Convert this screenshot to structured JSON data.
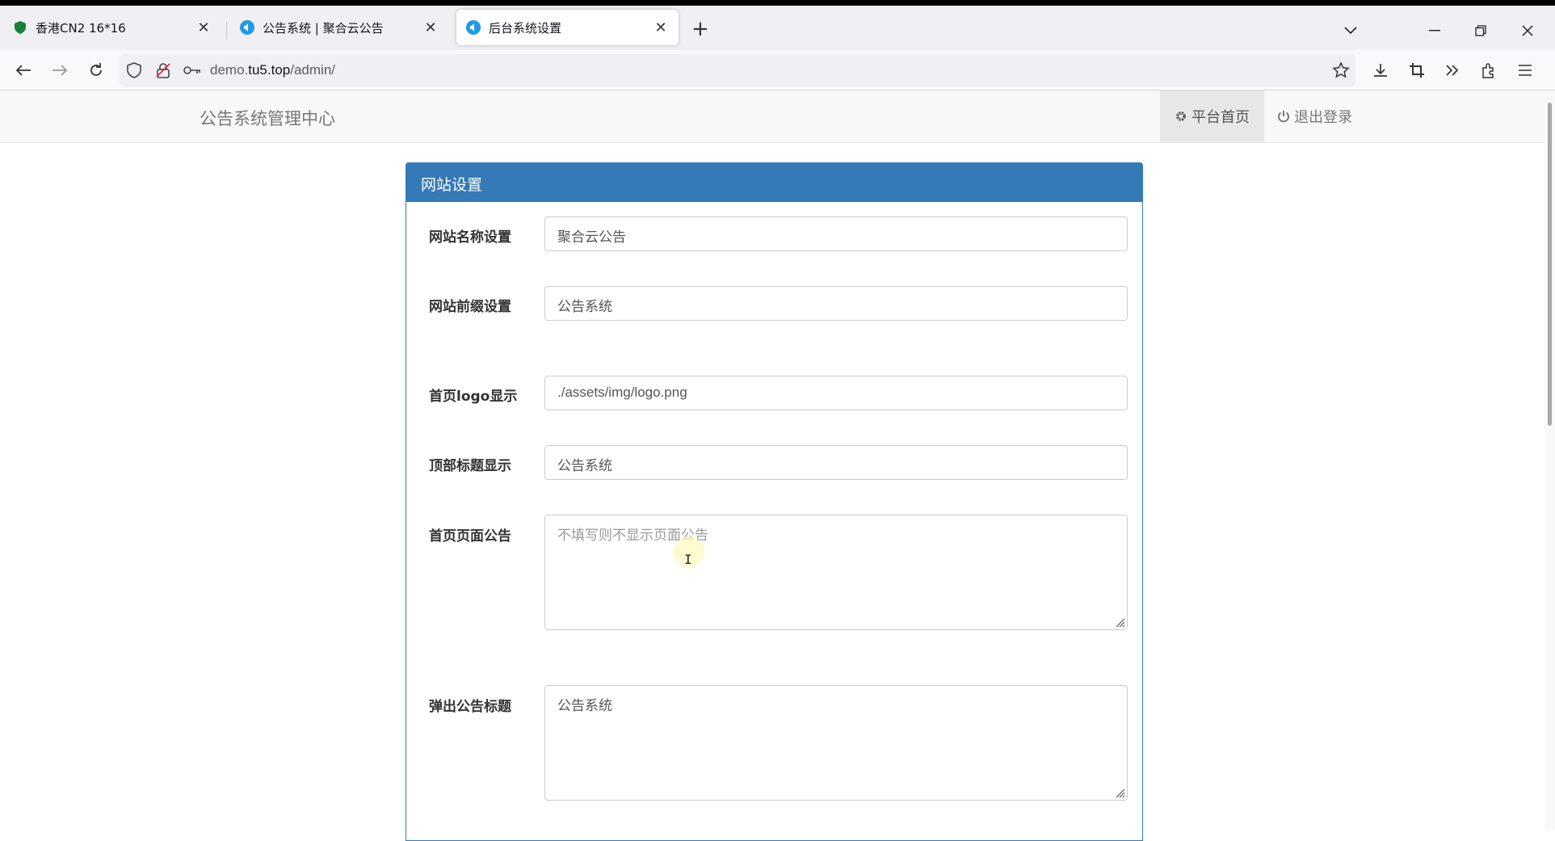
{
  "browser": {
    "tabs": [
      {
        "title": "香港CN2 16*16",
        "active": false
      },
      {
        "title": "公告系统 | 聚合云公告",
        "active": false
      },
      {
        "title": "后台系统设置",
        "active": true
      }
    ],
    "url_prefix": "demo.",
    "url_domain": "tu5.top",
    "url_path": "/admin/"
  },
  "site": {
    "brand": "公告系统管理中心",
    "nav": [
      {
        "label": "平台首页",
        "icon": "gear-icon"
      },
      {
        "label": "退出登录",
        "icon": "power-icon"
      }
    ]
  },
  "panel": {
    "title": "网站设置",
    "fields": {
      "site_name": {
        "label": "网站名称设置",
        "value": "聚合云公告"
      },
      "site_prefix": {
        "label": "网站前缀设置",
        "value": "公告系统"
      },
      "logo": {
        "label": "首页logo显示",
        "value": "./assets/img/logo.png"
      },
      "top_title": {
        "label": "顶部标题显示",
        "value": "公告系统"
      },
      "home_notice": {
        "label": "首页页面公告",
        "value": "",
        "placeholder": "不填写则不显示页面公告"
      },
      "popup_title": {
        "label": "弹出公告标题",
        "value": "公告系统"
      }
    }
  },
  "colors": {
    "primary": "#337ab7",
    "navbar_bg": "#f8f8f8"
  }
}
